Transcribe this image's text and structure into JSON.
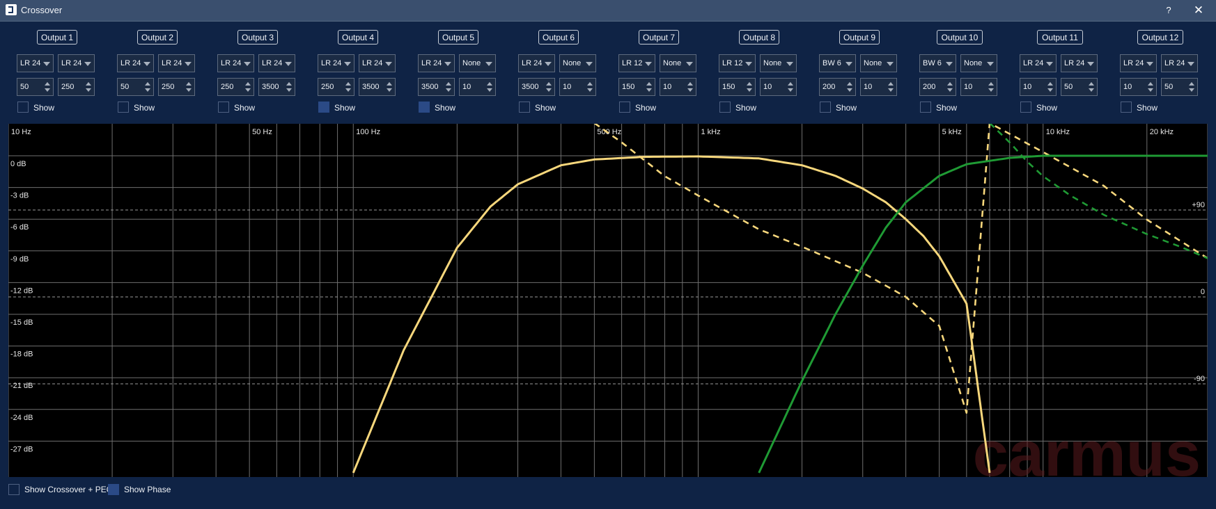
{
  "window": {
    "title": "Crossover",
    "help_label": "?",
    "close_label": "✕",
    "icon": "app-logo-icon"
  },
  "show_label": "Show",
  "outputs": [
    {
      "label": "Output 1",
      "hp_type": "LR 24",
      "lp_type": "LR 24",
      "hp_freq": "50",
      "lp_freq": "250",
      "show": false
    },
    {
      "label": "Output 2",
      "hp_type": "LR 24",
      "lp_type": "LR 24",
      "hp_freq": "50",
      "lp_freq": "250",
      "show": false
    },
    {
      "label": "Output 3",
      "hp_type": "LR 24",
      "lp_type": "LR 24",
      "hp_freq": "250",
      "lp_freq": "3500",
      "show": false
    },
    {
      "label": "Output 4",
      "hp_type": "LR 24",
      "lp_type": "LR 24",
      "hp_freq": "250",
      "lp_freq": "3500",
      "show": true
    },
    {
      "label": "Output 5",
      "hp_type": "LR 24",
      "lp_type": "None",
      "hp_freq": "3500",
      "lp_freq": "10",
      "show": true
    },
    {
      "label": "Output 6",
      "hp_type": "LR 24",
      "lp_type": "None",
      "hp_freq": "3500",
      "lp_freq": "10",
      "show": false
    },
    {
      "label": "Output 7",
      "hp_type": "LR 12",
      "lp_type": "None",
      "hp_freq": "150",
      "lp_freq": "10",
      "show": false
    },
    {
      "label": "Output 8",
      "hp_type": "LR 12",
      "lp_type": "None",
      "hp_freq": "150",
      "lp_freq": "10",
      "show": false
    },
    {
      "label": "Output 9",
      "hp_type": "BW 6",
      "lp_type": "None",
      "hp_freq": "200",
      "lp_freq": "10",
      "show": false
    },
    {
      "label": "Output 10",
      "hp_type": "BW 6",
      "lp_type": "None",
      "hp_freq": "200",
      "lp_freq": "10",
      "show": false
    },
    {
      "label": "Output 11",
      "hp_type": "LR 24",
      "lp_type": "LR 24",
      "hp_freq": "10",
      "lp_freq": "50",
      "show": false
    },
    {
      "label": "Output 12",
      "hp_type": "LR 24",
      "lp_type": "LR 24",
      "hp_freq": "10",
      "lp_freq": "50",
      "show": false
    }
  ],
  "bottom": {
    "show_crossover_peq": {
      "label": "Show Crossover + PEQ",
      "checked": false
    },
    "show_phase": {
      "label": "Show Phase",
      "checked": true
    }
  },
  "watermark": "carmus",
  "colors": {
    "background": "#0f2345",
    "titlebar": "#3a4f6e",
    "checkbox_on": "#2b4a86",
    "series_yellow": "#f7d77c",
    "series_green": "#1f9a34",
    "grid": "#6f6f6f"
  },
  "chart_data": {
    "type": "line",
    "title": "",
    "xlabel": "",
    "ylabel": "",
    "x_scale": "log",
    "xlim": [
      10,
      30000
    ],
    "ylim": [
      -30,
      1
    ],
    "x_tick_labels": [
      {
        "value": 10,
        "label": "10 Hz"
      },
      {
        "value": 50,
        "label": "50 Hz"
      },
      {
        "value": 100,
        "label": "100 Hz"
      },
      {
        "value": 500,
        "label": "500 Hz"
      },
      {
        "value": 1000,
        "label": "1 kHz"
      },
      {
        "value": 5000,
        "label": "5 kHz"
      },
      {
        "value": 10000,
        "label": "10 kHz"
      },
      {
        "value": 20000,
        "label": "20 kHz"
      }
    ],
    "y_ticks": [
      0,
      -3,
      -6,
      -9,
      -12,
      -15,
      -18,
      -21,
      -24,
      -27
    ],
    "y_tick_labels": [
      "0 dB",
      "-3 dB",
      "-6 dB",
      "-9 dB",
      "-12 dB",
      "-15 dB",
      "-18 dB",
      "-21 dB",
      "-24 dB",
      "-27 dB"
    ],
    "phase_axis": {
      "ticks": [
        90,
        0,
        -90
      ],
      "labels": [
        "+90",
        "0",
        "-90"
      ],
      "range": [
        -180,
        180
      ]
    },
    "grid": true,
    "series": [
      {
        "kind": "magnitude",
        "color": "#f7d77c",
        "style": "solid",
        "x": [
          100,
          140,
          200,
          250,
          300,
          400,
          500,
          700,
          1000,
          1500,
          2000,
          2500,
          3000,
          3500,
          4000,
          4500,
          5000,
          6000,
          7000
        ],
        "y": [
          -30.0,
          -18.4,
          -8.7,
          -4.8,
          -2.7,
          -0.9,
          -0.35,
          -0.1,
          -0.06,
          -0.25,
          -0.9,
          -1.9,
          -3.1,
          -4.4,
          -6.0,
          -7.6,
          -9.5,
          -14.0,
          -30.0
        ]
      },
      {
        "kind": "phase",
        "color": "#f7d77c",
        "style": "dashed",
        "x": [
          500,
          600,
          800,
          1000,
          1500,
          2000,
          3000,
          4000,
          5000,
          6000,
          7000,
          10000,
          15000,
          20000,
          30000
        ],
        "y": [
          180,
          160,
          125,
          105,
          70,
          52,
          25,
          0,
          -30,
          -120,
          180,
          150,
          115,
          80,
          40
        ]
      },
      {
        "kind": "magnitude",
        "color": "#1f9a34",
        "style": "solid",
        "x": [
          1500,
          2000,
          2500,
          3000,
          3500,
          4000,
          5000,
          6000,
          8000,
          10000,
          20000,
          30000
        ],
        "y": [
          -30.0,
          -21.3,
          -15.0,
          -10.4,
          -6.8,
          -4.4,
          -1.9,
          -0.8,
          -0.2,
          0.0,
          0.0,
          0.0
        ]
      },
      {
        "kind": "phase",
        "color": "#1f9a34",
        "style": "dashed",
        "x": [
          7000,
          8000,
          9000,
          10000,
          12000,
          15000,
          20000,
          25000,
          30000
        ],
        "y": [
          180,
          160,
          140,
          125,
          105,
          85,
          65,
          52,
          40
        ]
      }
    ]
  }
}
